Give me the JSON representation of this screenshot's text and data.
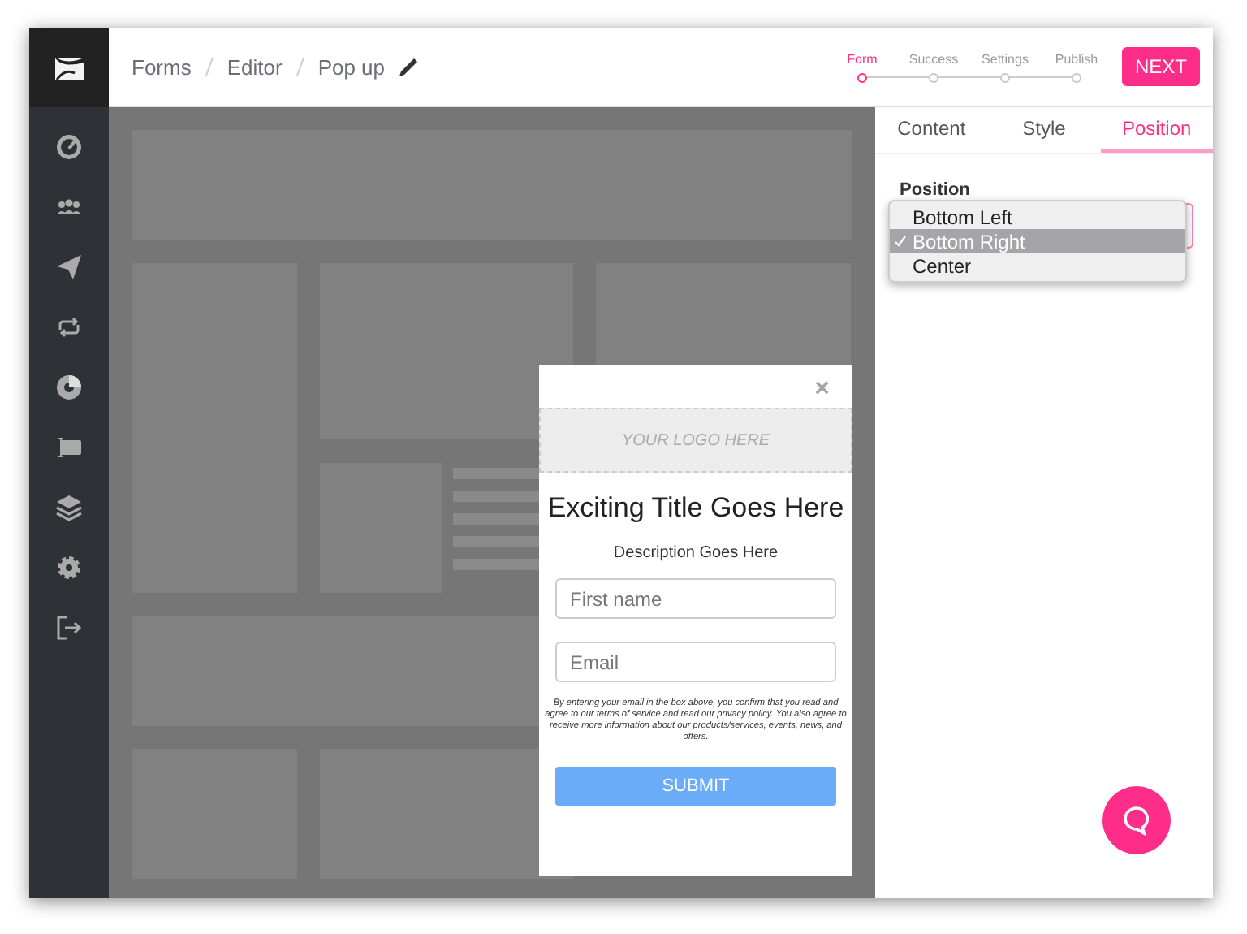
{
  "breadcrumb": [
    {
      "label": "Forms"
    },
    {
      "label": "Editor"
    },
    {
      "label": "Pop up"
    }
  ],
  "steps": [
    {
      "label": "Form",
      "selected": true
    },
    {
      "label": "Success",
      "selected": false
    },
    {
      "label": "Settings",
      "selected": false
    },
    {
      "label": "Publish",
      "selected": false
    }
  ],
  "next_button": "NEXT",
  "tabs": [
    {
      "label": "Content",
      "selected": false
    },
    {
      "label": "Style",
      "selected": false
    },
    {
      "label": "Position",
      "selected": true
    }
  ],
  "position_field": {
    "label": "Position",
    "options": [
      {
        "label": "Bottom Left",
        "selected": false
      },
      {
        "label": "Bottom Right",
        "selected": true
      },
      {
        "label": "Center",
        "selected": false
      }
    ]
  },
  "popup": {
    "close": "×",
    "logo_placeholder": "YOUR LOGO HERE",
    "title": "Exciting Title Goes Here",
    "description": "Description Goes Here",
    "fields": [
      {
        "placeholder": "First name"
      },
      {
        "placeholder": "Email"
      }
    ],
    "disclaimer": "By entering your email in the box above, you confirm that you read and agree to our terms of service and read our privacy policy. You also agree to receive more information about our products/services, events, news, and offers.",
    "submit": "SUBMIT"
  }
}
